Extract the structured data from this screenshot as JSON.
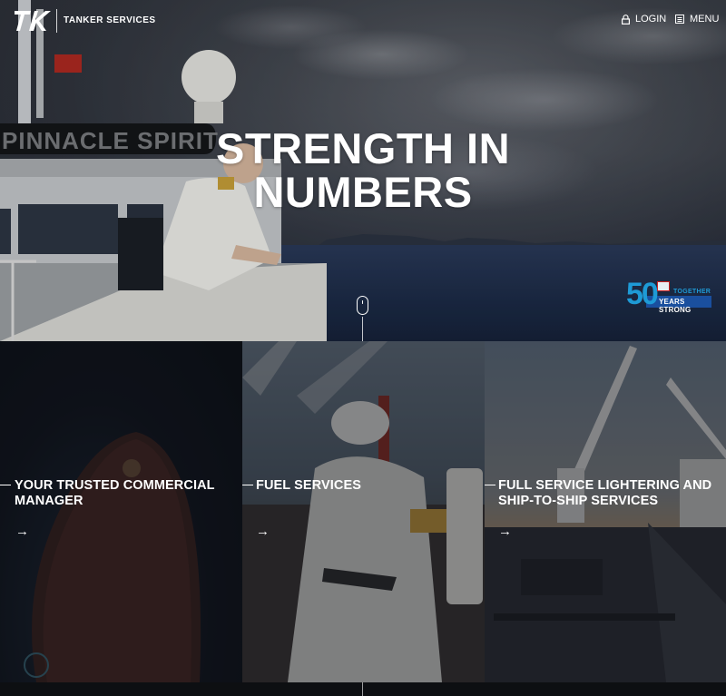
{
  "header": {
    "logo_text": "TK",
    "brand": "TANKER SERVICES",
    "login_label": "LOGIN",
    "login_icon": "lock-icon",
    "menu_label": "MENU",
    "menu_icon": "menu-icon"
  },
  "hero": {
    "title_line1": "STRENGTH IN",
    "title_line2": "NUMBERS",
    "ship_name": "PINNACLE SPIRIT",
    "badge": {
      "number": "50",
      "top_text": "TOGETHER",
      "bottom_text": "YEARS STRONG",
      "color": "#1e9ad6"
    },
    "scroll_icon": "mouse-scroll-icon"
  },
  "cards": [
    {
      "title": "YOUR TRUSTED COMMERCIAL MANAGER",
      "arrow": "→"
    },
    {
      "title": "FUEL SERVICES",
      "arrow": "→"
    },
    {
      "title": "FULL SERVICE LIGHTERING AND SHIP-TO-SHIP SERVICES",
      "arrow": "→"
    }
  ]
}
